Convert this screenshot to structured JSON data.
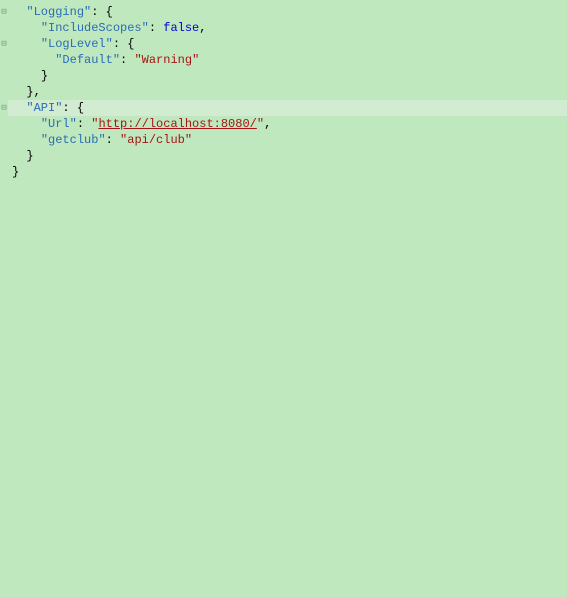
{
  "colors": {
    "background": "#bfe8be",
    "highlight_line": "#d1ecd0",
    "key": "#2b6db2",
    "string": "#a31515",
    "boolean": "#0000d6",
    "punct": "#000000",
    "gutter_glyph": "#7a9a7a"
  },
  "gutter": {
    "glyph": "⊟"
  },
  "json": {
    "Logging": {
      "key": "Logging",
      "IncludeScopes": {
        "key": "IncludeScopes",
        "value": "false"
      },
      "LogLevel": {
        "key": "LogLevel",
        "Default": {
          "key": "Default",
          "value": "Warning"
        }
      }
    },
    "API": {
      "key": "API",
      "Url": {
        "key": "Url",
        "q": "\"",
        "value": "http://localhost:8080/"
      },
      "getclub": {
        "key": "getclub",
        "value": "api/club"
      }
    }
  },
  "sym": {
    "q": "\"",
    "colon": ":",
    "colon_sp": ": ",
    "lbrace": "{",
    "rbrace": "}",
    "comma": ",",
    "rbrace_comma": "},"
  },
  "indent": {
    "i1": "  ",
    "i2": "    ",
    "i3": "      "
  }
}
